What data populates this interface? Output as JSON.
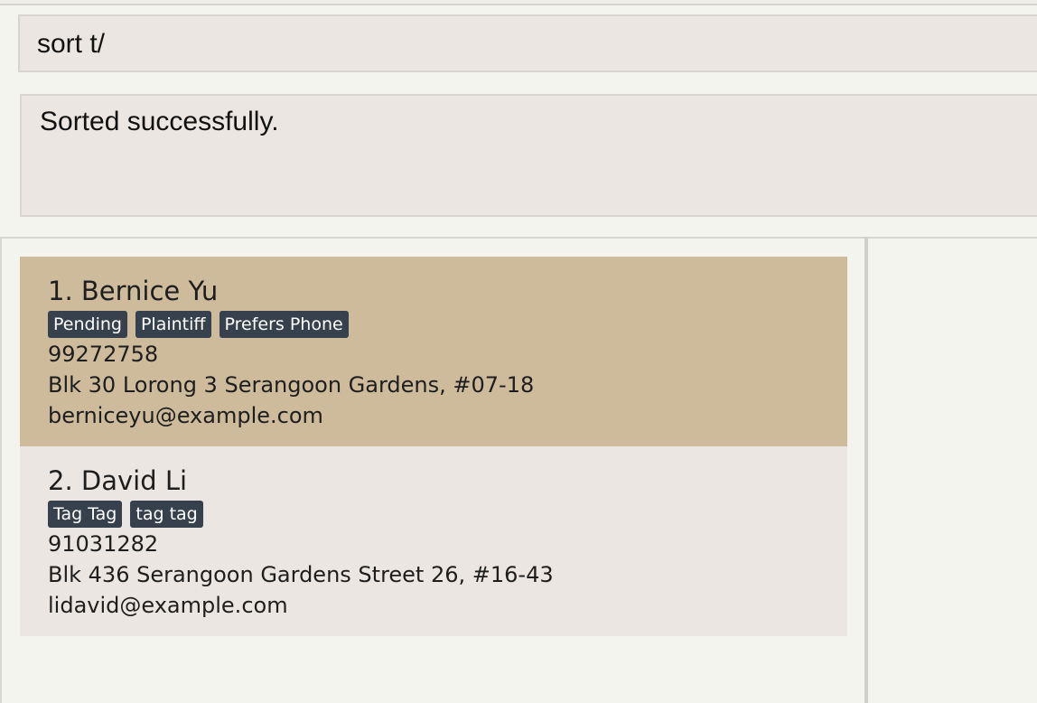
{
  "command_box": {
    "value": "sort t/"
  },
  "result_display": {
    "text": "Sorted successfully."
  },
  "persons": [
    {
      "index_name": "1. Bernice Yu",
      "tags": [
        "Pending",
        "Plaintiff",
        "Prefers Phone"
      ],
      "phone": "99272758",
      "address": "Blk 30 Lorong 3 Serangoon Gardens, #07-18",
      "email": "berniceyu@example.com",
      "selected": true
    },
    {
      "index_name": "2. David Li",
      "tags": [
        "Tag Tag",
        "tag tag"
      ],
      "phone": "91031282",
      "address": "Blk 436 Serangoon Gardens Street 26, #16-43",
      "email": "lidavid@example.com",
      "selected": false
    }
  ],
  "colors": {
    "selected_card": "#cdbb9c",
    "card": "#ebe6e1",
    "tag": "#37414d",
    "background": "#f4f4ee"
  }
}
